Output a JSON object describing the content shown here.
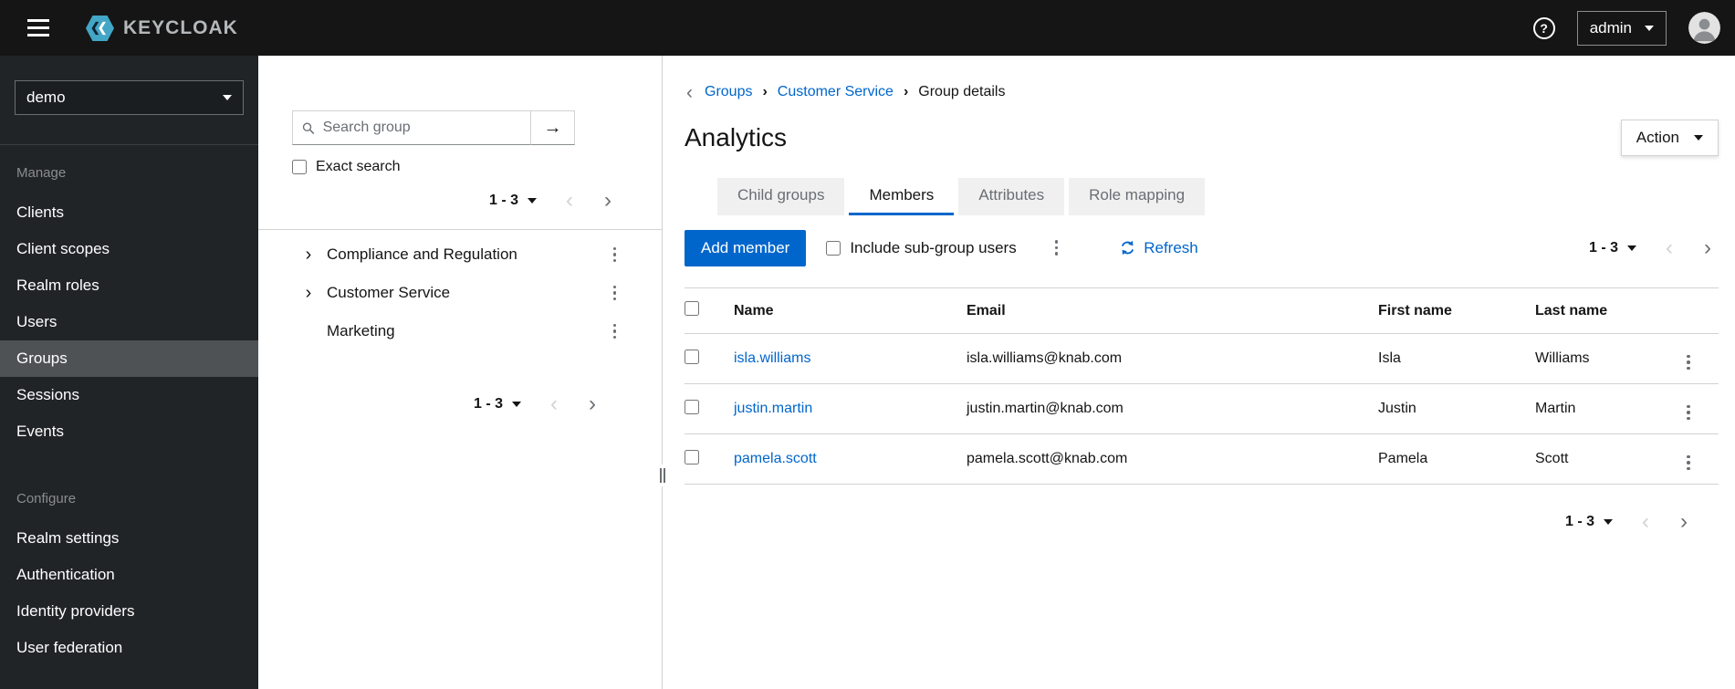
{
  "colors": {
    "accent": "#0066cc",
    "masthead_bg": "#151515",
    "sidebar_bg": "#212427",
    "sidebar_active_bg": "#4f5255",
    "link": "#0066cc",
    "border": "#d2d2d2"
  },
  "icons": {
    "chevron_left": "‹",
    "chevron_right": "›",
    "angle_right": "›",
    "breadcrumb_back": "‹",
    "breadcrumb_separator": "›",
    "arrow_right": "→",
    "help": "?"
  },
  "header": {
    "brand": "KEYCLOAK",
    "user": "admin"
  },
  "sidebar": {
    "realm": "demo",
    "manage": {
      "label": "Manage",
      "items": [
        "Clients",
        "Client scopes",
        "Realm roles",
        "Users",
        "Groups",
        "Sessions",
        "Events"
      ]
    },
    "configure": {
      "label": "Configure",
      "items": [
        "Realm settings",
        "Authentication",
        "Identity providers",
        "User federation"
      ]
    },
    "active_item": "Groups"
  },
  "group_panel": {
    "search": {
      "placeholder": "Search group"
    },
    "exact_search_label": "Exact search",
    "pagination_top": {
      "range": "1 - 3"
    },
    "pagination_bottom": {
      "range": "1 - 3"
    },
    "tree": [
      {
        "label": "Compliance and Regulation",
        "expandable": true
      },
      {
        "label": "Customer Service",
        "expandable": true
      },
      {
        "label": "Marketing",
        "expandable": false
      }
    ]
  },
  "main": {
    "breadcrumb": {
      "items": [
        "Groups",
        "Customer Service",
        "Group details"
      ]
    },
    "title": "Analytics",
    "action_label": "Action",
    "tabs": {
      "items": [
        "Child groups",
        "Members",
        "Attributes",
        "Role mapping"
      ],
      "active": "Members"
    },
    "toolbar": {
      "add_member_label": "Add member",
      "include_subgroups_label": "Include sub-group users",
      "refresh_label": "Refresh",
      "pagination": {
        "range": "1 - 3"
      }
    },
    "table": {
      "columns": [
        "Name",
        "Email",
        "First name",
        "Last name"
      ],
      "rows": [
        {
          "name": "isla.williams",
          "email": "isla.williams@knab.com",
          "first": "Isla",
          "last": "Williams"
        },
        {
          "name": "justin.martin",
          "email": "justin.martin@knab.com",
          "first": "Justin",
          "last": "Martin"
        },
        {
          "name": "pamela.scott",
          "email": "pamela.scott@knab.com",
          "first": "Pamela",
          "last": "Scott"
        }
      ]
    },
    "pagination_bottom": {
      "range": "1 - 3"
    }
  }
}
